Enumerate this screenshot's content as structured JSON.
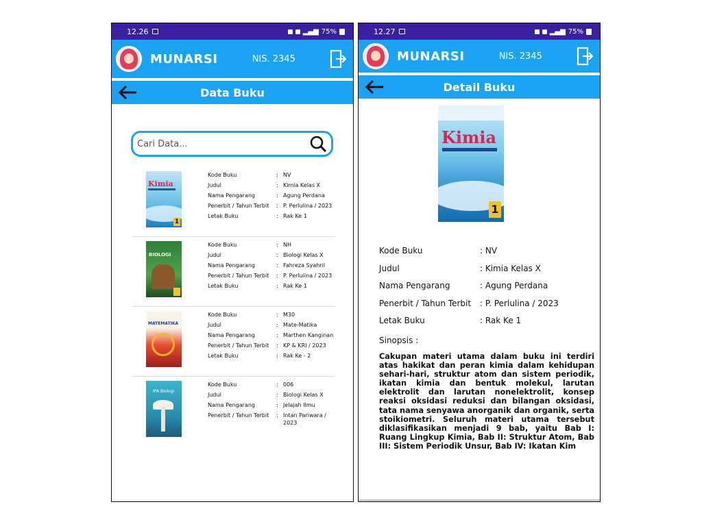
{
  "left_screen": {
    "status": {
      "time": "12.26",
      "battery": "75%"
    },
    "header": {
      "name": "MUNARSI",
      "nis": "NIS. 2345"
    },
    "title": "Data Buku",
    "search": {
      "placeholder": "Cari Data..."
    },
    "books": [
      {
        "cover": "kimia",
        "cover_title": "Kimia",
        "rows": [
          {
            "k": "Kode Buku",
            "v": "NV"
          },
          {
            "k": "Judul",
            "v": "Kimia Kelas X"
          },
          {
            "k": "Nama Pengarang",
            "v": "Agung Perdana"
          },
          {
            "k": "Penerbit / Tahun Terbit",
            "v": "P. Perlulina / 2023"
          },
          {
            "k": "Letak Buku",
            "v": "Rak Ke 1"
          }
        ]
      },
      {
        "cover": "biologi",
        "cover_title": "BIOLOGI",
        "rows": [
          {
            "k": "Kode Buku",
            "v": "NH"
          },
          {
            "k": "Judul",
            "v": "Biologi Kelas X"
          },
          {
            "k": "Nama Pengarang",
            "v": "Fahreza Syahril"
          },
          {
            "k": "Penerbit / Tahun Terbit",
            "v": "P. Perlulina / 2023"
          },
          {
            "k": "Letak Buku",
            "v": "Rak Ke 1"
          }
        ]
      },
      {
        "cover": "matematika",
        "cover_title": "MATEMATIKA",
        "rows": [
          {
            "k": "Kode Buku",
            "v": "M30"
          },
          {
            "k": "Judul",
            "v": "Mate-Matika"
          },
          {
            "k": "Nama Pengarang",
            "v": "Marthen Kanginan"
          },
          {
            "k": "Penerbit / Tahun Terbit",
            "v": "KP & KRI / 2023"
          },
          {
            "k": "Letak Buku",
            "v": "Rak Ke - 2"
          }
        ]
      },
      {
        "cover": "ipa",
        "cover_title": "IPA Biologi",
        "rows": [
          {
            "k": "Kode Buku",
            "v": "006"
          },
          {
            "k": "Judul",
            "v": "Biologi Kelas X"
          },
          {
            "k": "Nama Pengarang",
            "v": "Jelajah Ilmu"
          },
          {
            "k": "Penerbit / Tahun Terbit",
            "v": "Intan Pariwara / 2023"
          }
        ]
      }
    ]
  },
  "right_screen": {
    "status": {
      "time": "12.27",
      "battery": "75%"
    },
    "header": {
      "name": "MUNARSI",
      "nis": "NIS. 2345"
    },
    "title": "Detail Buku",
    "cover_title": "Kimia",
    "cover_number": "1",
    "details": [
      {
        "k": "Kode Buku",
        "v": ": NV"
      },
      {
        "k": "Judul",
        "v": ": Kimia Kelas X"
      },
      {
        "k": "Nama Pengarang",
        "v": ": Agung Perdana"
      },
      {
        "k": "Penerbit / Tahun Terbit",
        "v": ": P. Perlulina / 2023"
      },
      {
        "k": "Letak Buku",
        "v": ": Rak Ke 1"
      }
    ],
    "synopsis_label": "Sinopsis :",
    "synopsis": "Cakupan materi utama dalam buku ini terdiri atas hakikat dan peran kimia dalam kehidupan sehari-hari, struktur atom dan sistem periodik, ikatan kimia dan bentuk molekul, larutan elektrolit dan larutan nonelektrolit, konsep reaksi oksidasi reduksi dan bilangan oksidasi, tata nama senyawa anorganik dan organik, serta stoikiometri. Seluruh materi utama tersebut diklasifikasikan menjadi 9 bab, yaitu Bab I: Ruang Lingkup Kimia, Bab II: Struktur Atom, Bab III: Sistem Periodik Unsur, Bab IV: Ikatan Kim"
  },
  "colors": {
    "status_bar": "#3b1fa0",
    "app_bar": "#1aa3f3"
  },
  "icons": [
    "image-icon",
    "logout-icon",
    "back-arrow-icon",
    "search-icon",
    "avatar"
  ]
}
